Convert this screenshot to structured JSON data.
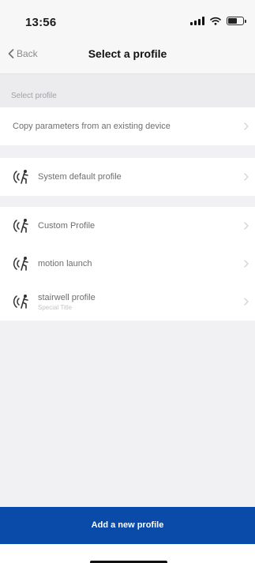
{
  "status_bar": {
    "time": "13:56"
  },
  "nav": {
    "back_label": "Back",
    "title": "Select a profile"
  },
  "section": {
    "header": "Select profile"
  },
  "copy_row": {
    "label": "Copy parameters from an existing device"
  },
  "default_profile": {
    "label": "System default profile"
  },
  "profiles": [
    {
      "label": "Custom Profile"
    },
    {
      "label": "motion launch"
    },
    {
      "label": "stairwell profile",
      "sublabel": "Special Title"
    }
  ],
  "actions": {
    "add_profile": "Add a new profile"
  },
  "colors": {
    "accent": "#0a4aa8",
    "background": "#f1f1f3"
  }
}
